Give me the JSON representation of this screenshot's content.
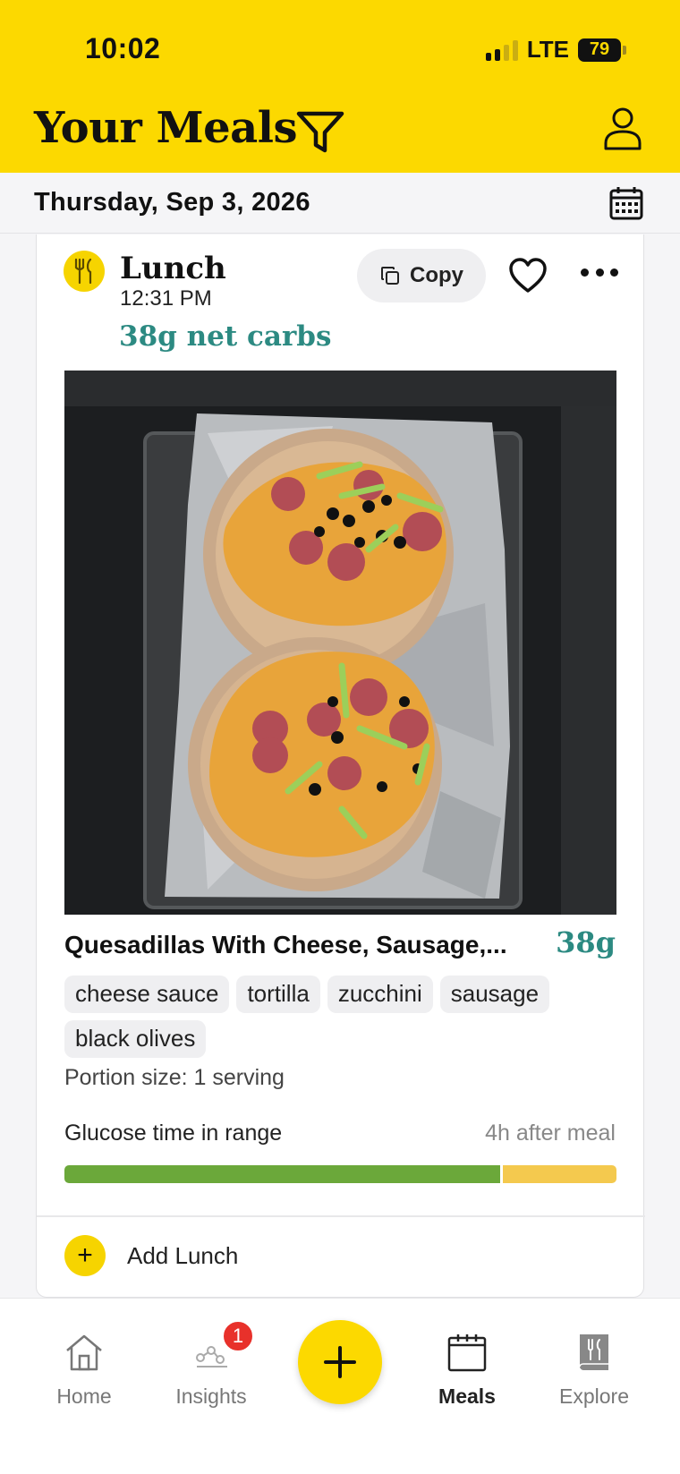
{
  "status_bar": {
    "time": "10:02",
    "network": "LTE",
    "battery": "79"
  },
  "header": {
    "title": "Your Meals",
    "icons": [
      "filter-icon",
      "profile-icon"
    ]
  },
  "date_bar": {
    "date": "Thursday, Sep 3, 2026",
    "icon": "calendar-icon"
  },
  "meal_card": {
    "meal_type": "Lunch",
    "time": "12:31 PM",
    "net_carbs": "38g net carbs",
    "copy_label": "Copy",
    "food": {
      "name": "Quesadillas With Cheese, Sausage,...",
      "carbs": "38g",
      "ingredients": [
        "cheese sauce",
        "tortilla",
        "zucchini",
        "sausage",
        "black olives"
      ],
      "portion": "Portion size: 1 serving"
    },
    "glucose": {
      "label": "Glucose time in range",
      "window": "4h after meal",
      "in_range_fraction": 0.79,
      "colors": {
        "in_range": "#6ba83a",
        "above": "#f4c94e"
      }
    },
    "add_label": "Add Lunch"
  },
  "tab_bar": {
    "tabs": [
      {
        "label": "Home",
        "icon": "home-icon",
        "active": false
      },
      {
        "label": "Insights",
        "icon": "insights-icon",
        "active": false,
        "badge": "1"
      },
      {
        "label": "",
        "icon": "plus-icon",
        "fab": true
      },
      {
        "label": "Meals",
        "icon": "meals-calendar-icon",
        "active": true
      },
      {
        "label": "Explore",
        "icon": "explore-book-icon",
        "active": false
      }
    ]
  },
  "colors": {
    "brand_yellow": "#fcd900",
    "carb_teal": "#2c8a82",
    "badge_red": "#e8312b"
  }
}
